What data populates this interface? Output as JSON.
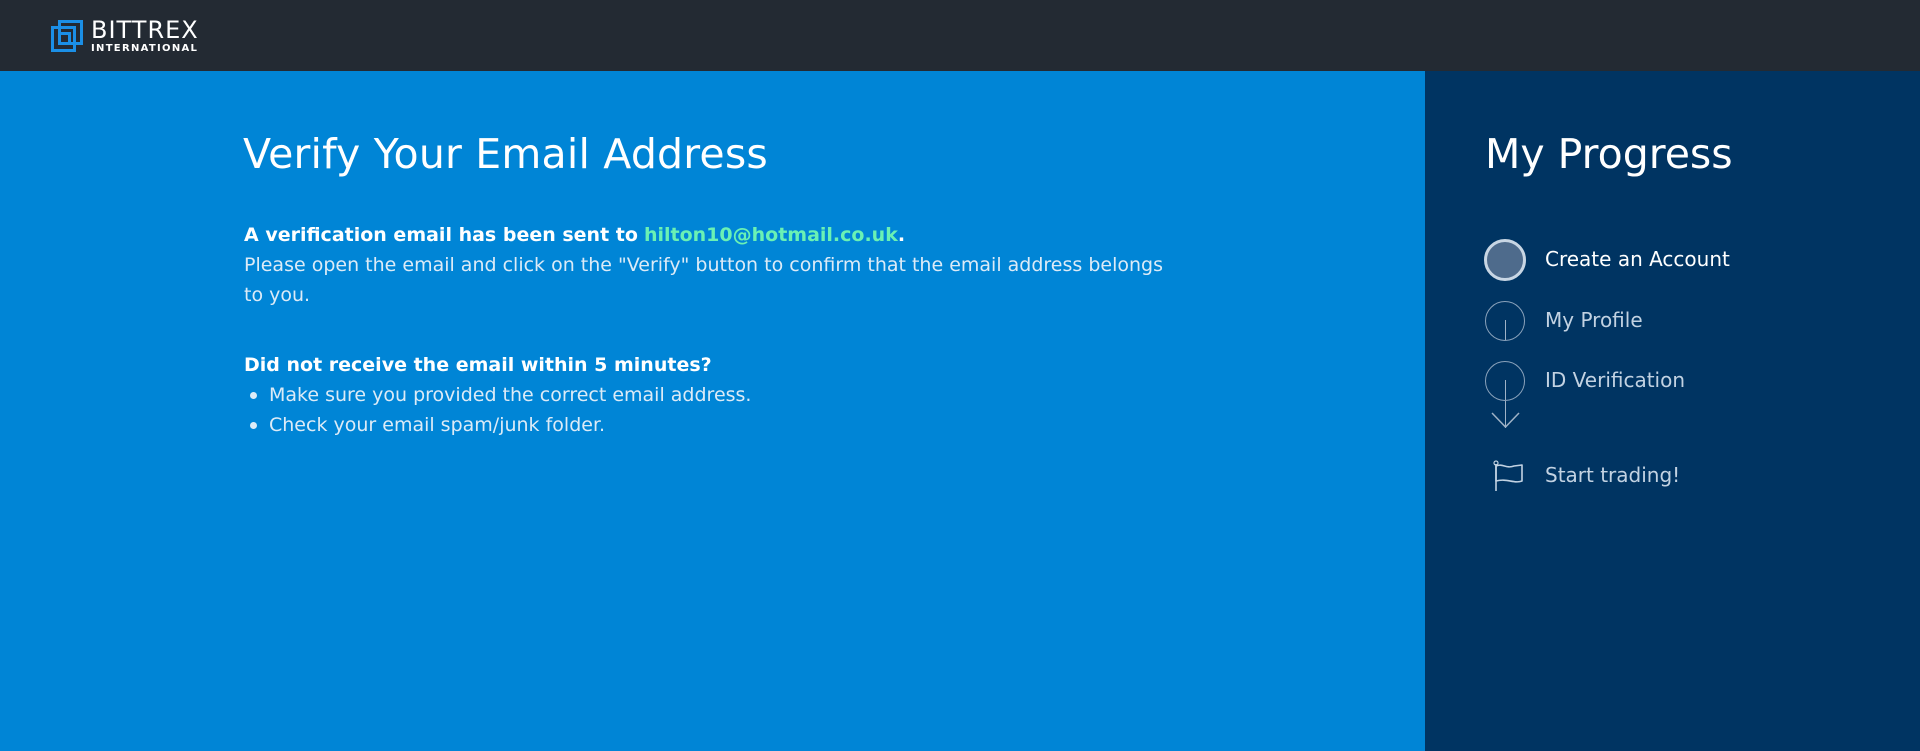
{
  "brand": {
    "name": "BITTREX",
    "sub": "INTERNATIONAL"
  },
  "main": {
    "title": "Verify Your Email Address",
    "sent_prefix": "A verification email has been sent to",
    "email": "hilton10@hotmail.co.uk",
    "sent_suffix": ".",
    "instruction": "Please open the email and click on the \"Verify\" button to confirm that the email address belongs to you.",
    "question": "Did not receive the email within 5 minutes?",
    "tips": [
      "Make sure you provided the correct email address.",
      "Check your email spam/junk folder."
    ]
  },
  "progress": {
    "title": "My Progress",
    "steps": [
      {
        "label": "Create an Account",
        "state": "current"
      },
      {
        "label": "My Profile",
        "state": "pending"
      },
      {
        "label": "ID Verification",
        "state": "pending"
      }
    ],
    "final": {
      "label": "Start trading!",
      "icon": "flag-icon"
    }
  },
  "colors": {
    "topbar": "#232a33",
    "main_bg": "#0085d6",
    "sidebar_bg": "#003462",
    "email_accent": "#6af1b4",
    "logo_accent": "#1b8fe6"
  }
}
